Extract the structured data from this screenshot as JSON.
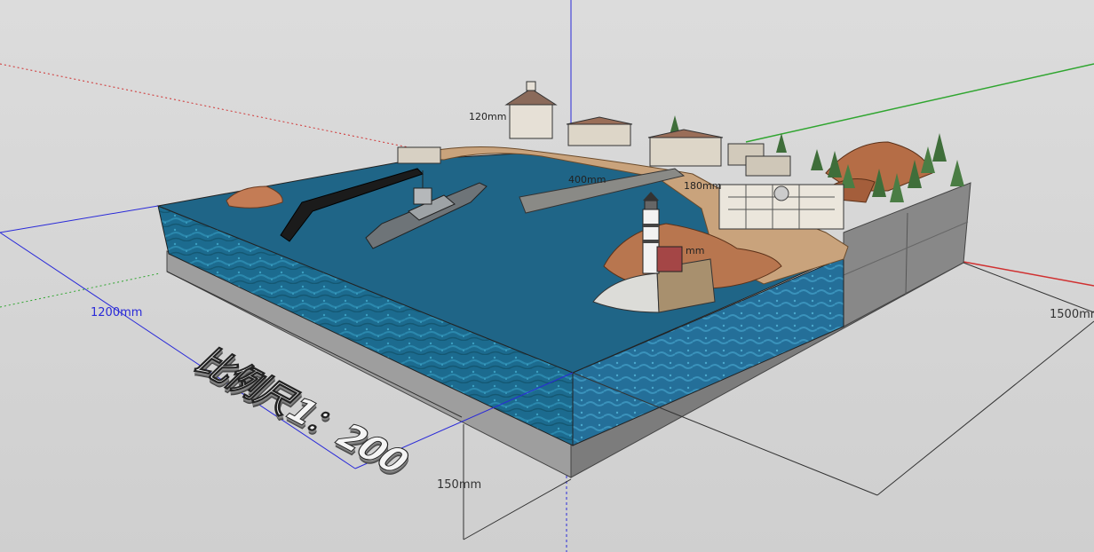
{
  "dimensions": {
    "width_label": "1200mm",
    "depth_label": "1500mm",
    "height_label": "150mm",
    "pier_label": "400mm",
    "building_label": "120mm",
    "dock_label": "180mm",
    "lighthouse_label": "mm"
  },
  "scale_text": "比例尺1：200",
  "colors": {
    "background": "#d4d4d4",
    "water": "#1d6f93",
    "base": "#9b9b9b",
    "sand": "#c7a27c",
    "rock": "#b8764f",
    "axis_red": "#d03030",
    "axis_green": "#2fa52f",
    "axis_blue": "#2a2ad8"
  }
}
